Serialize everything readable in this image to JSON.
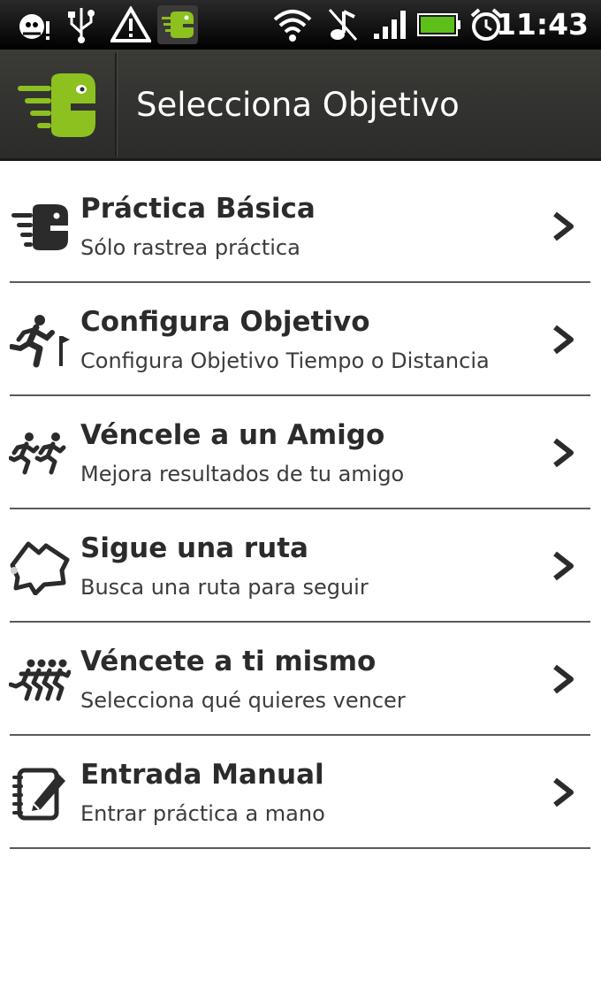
{
  "status_bar": {
    "time": "11:43",
    "icons": [
      "android-debug-icon",
      "usb-icon",
      "warning-icon",
      "endomondo-notification-icon",
      "wifi-icon",
      "music-off-icon",
      "signal-icon",
      "battery-icon",
      "alarm-icon"
    ]
  },
  "app_bar": {
    "title": "Selecciona Objetivo",
    "brand_color": "#8cc11f"
  },
  "items": [
    {
      "title": "Práctica Básica",
      "subtitle": "Sólo rastrea práctica",
      "icon": "runner-blob-icon"
    },
    {
      "title": "Configura Objetivo",
      "subtitle": "Configura Objetivo Tiempo o Distancia",
      "icon": "runner-flag-icon"
    },
    {
      "title": "Véncele a un Amigo",
      "subtitle": "Mejora resultados de tu amigo",
      "icon": "two-runners-icon"
    },
    {
      "title": "Sigue una ruta",
      "subtitle": "Busca una ruta para seguir",
      "icon": "route-map-icon"
    },
    {
      "title": "Véncete a ti mismo",
      "subtitle": "Selecciona qué quieres vencer",
      "icon": "runner-group-icon"
    },
    {
      "title": "Entrada Manual",
      "subtitle": "Entrar práctica a mano",
      "icon": "notepad-pencil-icon"
    }
  ]
}
